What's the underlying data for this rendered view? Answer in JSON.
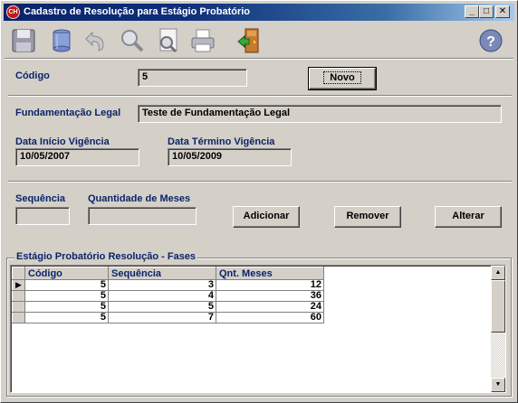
{
  "window": {
    "title": "Cadastro de Resolução para Estágio Probatório",
    "app_icon_text": "CH",
    "controls": {
      "minimize": "_",
      "maximize": "□",
      "close": "✕"
    }
  },
  "toolbar": {
    "icons": [
      "save-icon",
      "database-icon",
      "undo-icon",
      "search-icon",
      "zoom-document-icon",
      "print-icon",
      "exit-icon",
      "help-icon"
    ],
    "help_label": "?"
  },
  "form": {
    "codigo_label": "Código",
    "codigo_value": "5",
    "novo_button": "Novo",
    "fundamentacao_label": "Fundamentação Legal",
    "fundamentacao_value": "Teste de Fundamentação Legal",
    "data_inicio_label": "Data Início Vigência",
    "data_inicio_value": "10/05/2007",
    "data_termino_label": "Data Término Vigência",
    "data_termino_value": "10/05/2009",
    "sequencia_label": "Sequência",
    "sequencia_value": "",
    "quantidade_label": "Quantidade de Meses",
    "quantidade_value": "",
    "adicionar_button": "Adicionar",
    "remover_button": "Remover",
    "alterar_button": "Alterar"
  },
  "grid": {
    "group_title": "Estágio Probatório Resolução - Fases",
    "columns": [
      "Código",
      "Sequência",
      "Qnt. Meses"
    ],
    "rows": [
      [
        "5",
        "3",
        "12"
      ],
      [
        "5",
        "4",
        "36"
      ],
      [
        "5",
        "5",
        "24"
      ],
      [
        "5",
        "7",
        "60"
      ]
    ],
    "current_row_marker": "▶"
  },
  "colors": {
    "title_start": "#0a246a",
    "title_end": "#a6caf0",
    "label_blue": "#0a246a",
    "face": "#d4d0c8"
  }
}
